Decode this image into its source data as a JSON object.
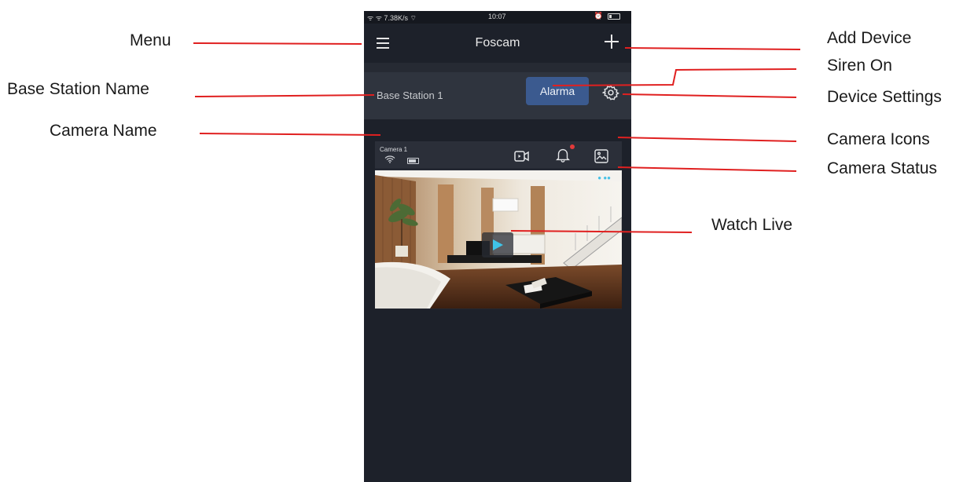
{
  "callouts": {
    "menu": "Menu",
    "base_station_name": "Base Station Name",
    "camera_name": "Camera Name",
    "add_device": "Add Device",
    "siren_on": "Siren On",
    "device_settings": "Device Settings",
    "camera_icons": "Camera Icons",
    "camera_status": "Camera Status",
    "watch_live": "Watch Live"
  },
  "status_bar": {
    "left": "ᯤ ᯤ 7.38K/s ⌔",
    "time": "10:07",
    "right_icon": "alarm-clock-icon"
  },
  "app": {
    "title": "Foscam",
    "base_station": "Base Station 1",
    "alarm_button": "Alarma",
    "camera_name": "Camera 1"
  },
  "colors": {
    "annotation_line": "#e02020",
    "alarm_button": "#3b5a8f",
    "status_dot": "#46c1e6",
    "notification_dot": "#e23a3a"
  },
  "icons": {
    "menu": "hamburger-menu-icon",
    "add": "plus-icon",
    "settings": "gear-icon",
    "record": "video-camera-icon",
    "alert": "bell-icon",
    "gallery": "image-icon",
    "signal": "wifi-icon",
    "battery": "battery-icon",
    "play": "play-icon"
  }
}
